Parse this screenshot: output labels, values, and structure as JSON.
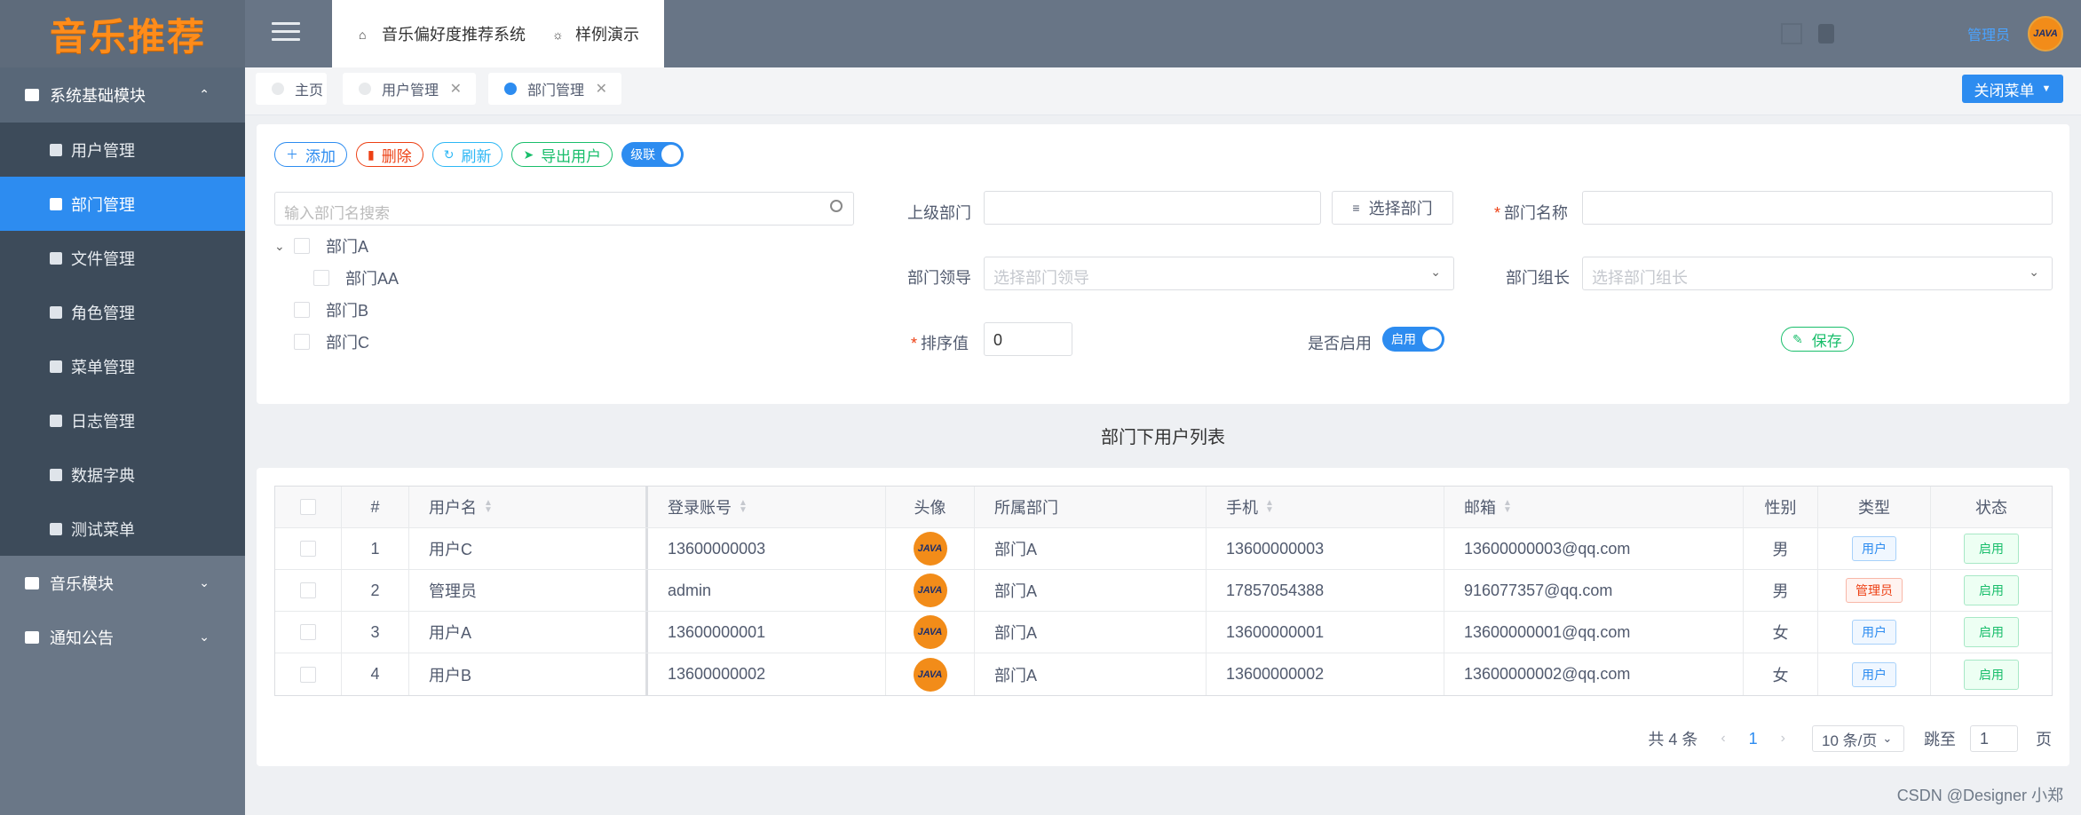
{
  "app": {
    "logo": "音乐推荐"
  },
  "sidebar": {
    "groups": [
      {
        "label": "系统基础模块",
        "expanded": true,
        "items": [
          {
            "label": "用户管理",
            "icon": "user-icon"
          },
          {
            "label": "部门管理",
            "icon": "branch-icon",
            "active": true
          },
          {
            "label": "文件管理",
            "icon": "folder-icon"
          },
          {
            "label": "角色管理",
            "icon": "users-icon"
          },
          {
            "label": "菜单管理",
            "icon": "list-icon"
          },
          {
            "label": "日志管理",
            "icon": "document-icon"
          },
          {
            "label": "数据字典",
            "icon": "grid-icon"
          },
          {
            "label": "测试菜单",
            "icon": "bug-icon"
          }
        ]
      },
      {
        "label": "音乐模块",
        "expanded": false
      },
      {
        "label": "通知公告",
        "expanded": false
      }
    ]
  },
  "topbar": {
    "nav": [
      {
        "label": "音乐偏好度推荐系统",
        "icon": "home-icon"
      },
      {
        "label": "样例演示",
        "icon": "bulb-icon"
      }
    ],
    "user": "管理员",
    "avatar_text": "JAVA"
  },
  "tabs": [
    {
      "label": "主页",
      "active": false,
      "closable": false
    },
    {
      "label": "用户管理",
      "active": false,
      "closable": true
    },
    {
      "label": "部门管理",
      "active": true,
      "closable": true
    }
  ],
  "close_menu_label": "关闭菜单",
  "toolbar": {
    "add": "添加",
    "delete": "删除",
    "refresh": "刷新",
    "export": "导出用户",
    "cascade": "级联"
  },
  "tree_search_placeholder": "输入部门名搜索",
  "tree": [
    {
      "label": "部门A",
      "expanded": true,
      "level": 0
    },
    {
      "label": "部门AA",
      "level": 1
    },
    {
      "label": "部门B",
      "level": 0
    },
    {
      "label": "部门C",
      "level": 0
    }
  ],
  "form": {
    "parent_label": "上级部门",
    "parent_value": "",
    "pick_label": "选择部门",
    "name_label": "部门名称",
    "name_value": "",
    "leader_label": "部门领导",
    "leader_placeholder": "选择部门领导",
    "head_label": "部门组长",
    "head_placeholder": "选择部门组长",
    "sort_label": "排序值",
    "sort_value": "0",
    "enable_label": "是否启用",
    "enable_switch": "启用",
    "save": "保存"
  },
  "table": {
    "title": "部门下用户列表",
    "headers": [
      "#",
      "用户名",
      "登录账号",
      "头像",
      "所属部门",
      "手机",
      "邮箱",
      "性别",
      "类型",
      "状态"
    ],
    "rows": [
      {
        "no": "1",
        "name": "用户C",
        "account": "13600000003",
        "dept": "部门A",
        "phone": "13600000003",
        "email": "13600000003@qq.com",
        "sex": "男",
        "type": "用户",
        "status": "启用"
      },
      {
        "no": "2",
        "name": "管理员",
        "account": "admin",
        "dept": "部门A",
        "phone": "17857054388",
        "email": "916077357@qq.com",
        "sex": "男",
        "type": "管理员",
        "status": "启用"
      },
      {
        "no": "3",
        "name": "用户A",
        "account": "13600000001",
        "dept": "部门A",
        "phone": "13600000001",
        "email": "13600000001@qq.com",
        "sex": "女",
        "type": "用户",
        "status": "启用"
      },
      {
        "no": "4",
        "name": "用户B",
        "account": "13600000002",
        "dept": "部门A",
        "phone": "13600000002",
        "email": "13600000002@qq.com",
        "sex": "女",
        "type": "用户",
        "status": "启用"
      }
    ]
  },
  "pager": {
    "total": "共 4 条",
    "page": "1",
    "page_size": "10 条/页",
    "jump_label": "跳至",
    "jump_value": "1",
    "page_unit": "页"
  },
  "watermark": "CSDN @Designer 小郑",
  "colors": {
    "primary": "#2d8cf0",
    "danger": "#ed4014",
    "success": "#19be6b",
    "info": "#2db7f5",
    "logo": "#ff8c1a"
  }
}
